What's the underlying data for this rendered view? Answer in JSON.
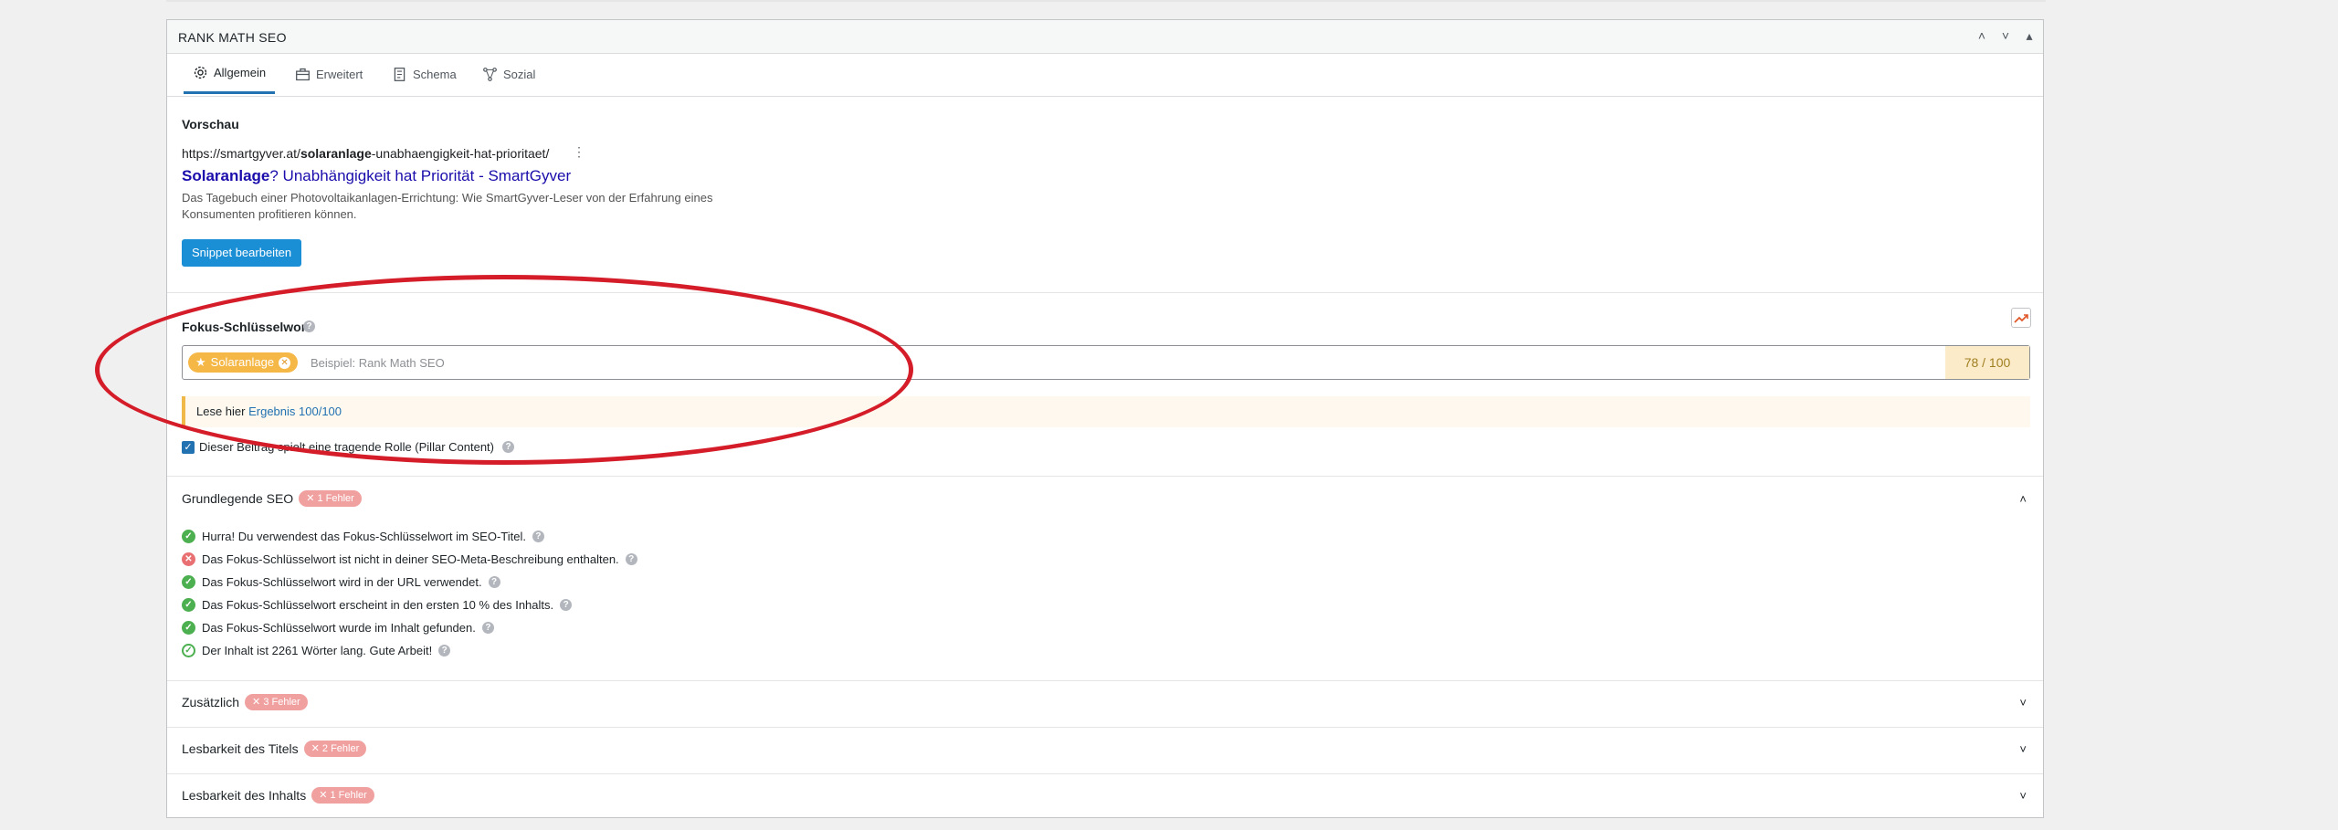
{
  "panel": {
    "title": "RANK MATH SEO",
    "controls": [
      "˄",
      "˅",
      "▴"
    ]
  },
  "tabs": [
    {
      "label": "Allgemein",
      "icon": "gear-icon"
    },
    {
      "label": "Erweitert",
      "icon": "toolbox-icon"
    },
    {
      "label": "Schema",
      "icon": "document-icon"
    },
    {
      "label": "Sozial",
      "icon": "share-nodes-icon"
    }
  ],
  "preview": {
    "heading": "Vorschau",
    "url_prefix": "https://smartgyver.at/",
    "url_keyword": "solaranlage",
    "url_suffix": "-unabhaengigkeit-hat-prioritaet/",
    "title_keyword": "Solaranlage",
    "title_rest": "? Unabhängigkeit hat Priorität - SmartGyver",
    "description": "Das Tagebuch einer Photovoltaikanlagen-Errichtung: Wie SmartGyver-Leser von der Erfahrung eines Konsumenten profitieren können.",
    "edit_button": "Snippet bearbeiten"
  },
  "focus_keyword": {
    "label": "Fokus-Schlüsselwort",
    "chip": "Solaranlage",
    "placeholder": "Beispiel: Rank Math SEO",
    "score": "78 / 100"
  },
  "notice": {
    "prefix": "Lese hier ",
    "link": "Ergebnis 100/100"
  },
  "pillar": {
    "label": "Dieser Beitrag spielt eine tragende Rolle (Pillar Content)"
  },
  "sections": {
    "basic": {
      "title": "Grundlegende SEO",
      "badge": "1 Fehler",
      "items": [
        {
          "status": "ok",
          "text": "Hurra! Du verwendest das Fokus-Schlüsselwort im SEO-Titel."
        },
        {
          "status": "error",
          "text": "Das Fokus-Schlüsselwort ist nicht in deiner SEO-Meta-Beschreibung enthalten."
        },
        {
          "status": "ok",
          "text": "Das Fokus-Schlüsselwort wird in der URL verwendet."
        },
        {
          "status": "ok",
          "text": "Das Fokus-Schlüsselwort erscheint in den ersten 10 % des Inhalts."
        },
        {
          "status": "ok",
          "text": "Das Fokus-Schlüsselwort wurde im Inhalt gefunden."
        },
        {
          "status": "ok-outline",
          "text": "Der Inhalt ist 2261 Wörter lang. Gute Arbeit!"
        }
      ]
    },
    "additional": {
      "title": "Zusätzlich",
      "badge": "3 Fehler"
    },
    "title_readability": {
      "title": "Lesbarkeit des Titels",
      "badge": "2 Fehler"
    },
    "content_readability": {
      "title": "Lesbarkeit des Inhalts",
      "badge": "1 Fehler"
    }
  },
  "colors": {
    "accent": "#2271b1",
    "error_badge": "#f1a0a0",
    "chip": "#f5b746",
    "annotation": "#d51d2a"
  }
}
